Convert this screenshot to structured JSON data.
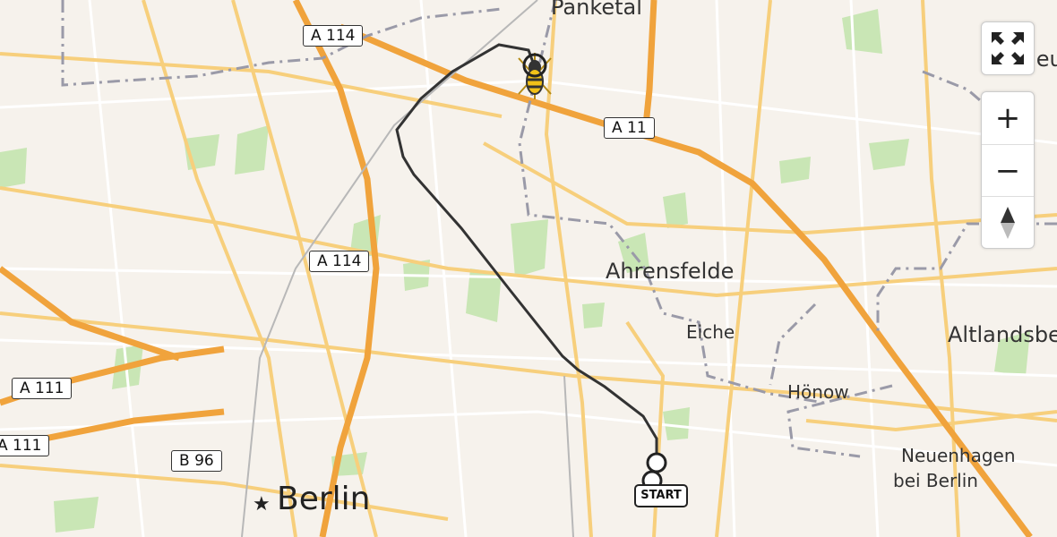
{
  "map": {
    "places": [
      {
        "id": "panketal",
        "name": "Panketal",
        "size": "mid"
      },
      {
        "id": "ahrensfelde",
        "name": "Ahrensfelde",
        "size": "mid"
      },
      {
        "id": "eiche",
        "name": "Eiche",
        "size": "small"
      },
      {
        "id": "hoenow",
        "name": "Hönow",
        "size": "small"
      },
      {
        "id": "altlandsberg",
        "name": "Altlandsbe",
        "size": "mid"
      },
      {
        "id": "neuenhagen1",
        "name": "Neuenhagen",
        "size": "small"
      },
      {
        "id": "neuenhagen2",
        "name": "bei Berlin",
        "size": "small"
      },
      {
        "id": "berlin",
        "name": "Berlin",
        "size": "big"
      },
      {
        "id": "werneuchen",
        "name": "Werneu",
        "size": "mid"
      }
    ],
    "road_shields": [
      {
        "id": "a114-top",
        "label": "A 114"
      },
      {
        "id": "a11",
        "label": "A 11"
      },
      {
        "id": "a114-mid",
        "label": "A 114"
      },
      {
        "id": "a111-a",
        "label": "A 111"
      },
      {
        "id": "a111-b",
        "label": "A 111"
      },
      {
        "id": "b96",
        "label": "B 96"
      }
    ],
    "route": {
      "start_label": "START",
      "destination_icon": "wasp-icon",
      "color": "#333333"
    },
    "colors": {
      "background": "#f6f2ec",
      "road_major": "#f5c05e",
      "road_motorway": "#f0a33c",
      "forest": "#c9e6b5",
      "boundary": "#9a9aa8"
    }
  },
  "controls": {
    "fullscreen_icon": "fullscreen-icon",
    "zoom_in": "+",
    "zoom_out": "−",
    "compass_icon": "compass-icon"
  }
}
